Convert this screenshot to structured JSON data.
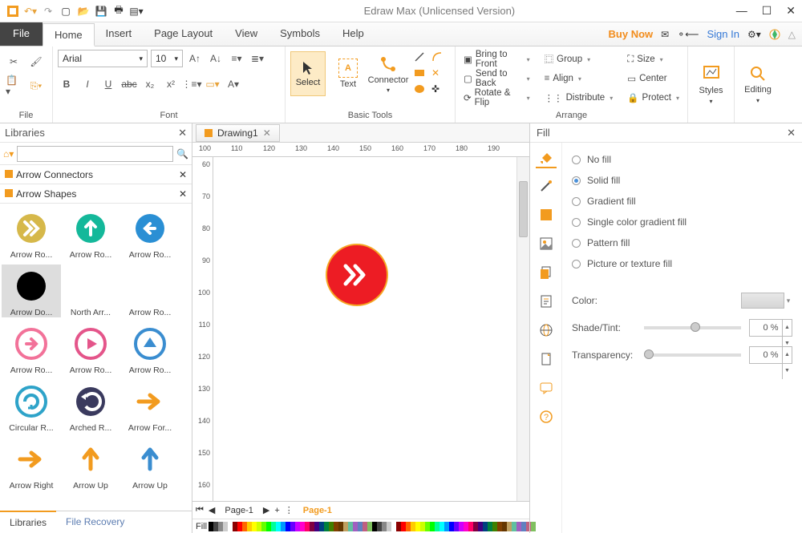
{
  "title": "Edraw Max (Unlicensed Version)",
  "menu": {
    "file": "File",
    "items": [
      "Home",
      "Insert",
      "Page Layout",
      "View",
      "Symbols",
      "Help"
    ],
    "active": 0,
    "buy": "Buy Now",
    "signin": "Sign In"
  },
  "ribbon": {
    "file_label": "File",
    "font_label": "Font",
    "font_name": "Arial",
    "font_size": "10",
    "basic_label": "Basic Tools",
    "select": "Select",
    "text": "Text",
    "connector": "Connector",
    "arrange_label": "Arrange",
    "arrange": {
      "bring": "Bring to Front",
      "send": "Send to Back",
      "rotate": "Rotate & Flip",
      "group": "Group",
      "align": "Align",
      "distribute": "Distribute",
      "size": "Size",
      "center": "Center",
      "protect": "Protect"
    },
    "styles": "Styles",
    "editing": "Editing"
  },
  "libraries": {
    "title": "Libraries",
    "cats": [
      "Arrow Connectors",
      "Arrow Shapes"
    ],
    "shapes": [
      {
        "label": "Arrow Ro...",
        "color": "#d6b84a",
        "sym": "chev"
      },
      {
        "label": "Arrow Ro...",
        "color": "#14b89a",
        "sym": "up"
      },
      {
        "label": "Arrow Ro...",
        "color": "#2a8fd4",
        "sym": "left"
      },
      {
        "label": "Arrow Do...",
        "sel": true
      },
      {
        "label": "North Arr...",
        "spacer": true
      },
      {
        "label": "Arrow Ro...",
        "spacer": true
      },
      {
        "label": "Arrow Ro...",
        "color": "#f27299",
        "sym": "right",
        "outline": true
      },
      {
        "label": "Arrow Ro...",
        "color": "#e4558a",
        "sym": "play",
        "outline": true
      },
      {
        "label": "Arrow Ro...",
        "color": "#3a8dd0",
        "sym": "tri",
        "outline": true
      },
      {
        "label": "Circular R...",
        "color": "#2ea3c9",
        "sym": "cycle",
        "outline": true
      },
      {
        "label": "Arched R...",
        "color": "#3a3a5e",
        "sym": "arch"
      },
      {
        "label": "Arrow For...",
        "color": "#f29b1f",
        "sym": "arrow"
      },
      {
        "label": "Arrow Right",
        "color": "#f29b1f",
        "sym": "arrow"
      },
      {
        "label": "Arrow Up",
        "color": "#f29b1f",
        "sym": "up2"
      },
      {
        "label": "Arrow Up",
        "color": "#3a8dd0",
        "sym": "up2"
      }
    ],
    "tabs": [
      "Libraries",
      "File Recovery"
    ],
    "active_tab": 0
  },
  "doc_tab": "Drawing1",
  "ruler_h": [
    100,
    110,
    120,
    130,
    140,
    150,
    160,
    170,
    180,
    190
  ],
  "ruler_v": [
    60,
    70,
    80,
    90,
    100,
    110,
    120,
    130,
    140,
    150,
    160
  ],
  "page_tab": "Page-1",
  "page_tab2": "Page-1",
  "fill_word": "Fill",
  "fill_panel": {
    "title": "Fill",
    "options": [
      "No fill",
      "Solid fill",
      "Gradient fill",
      "Single color gradient fill",
      "Pattern fill",
      "Picture or texture fill"
    ],
    "selected": 1,
    "color_label": "Color:",
    "shade_label": "Shade/Tint:",
    "trans_label": "Transparency:",
    "shade_val": "0 %",
    "trans_val": "0 %"
  }
}
